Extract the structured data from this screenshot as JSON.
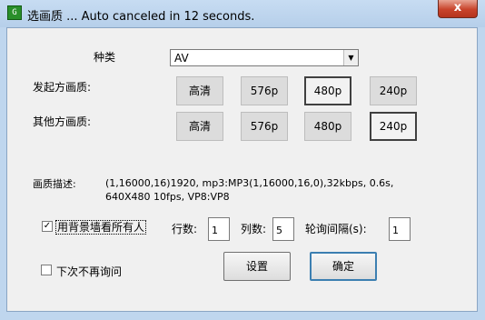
{
  "window": {
    "title": "选画质 ... Auto canceled in 12 seconds.",
    "icon_name": "app-icon",
    "close_label": "x"
  },
  "type": {
    "label": "种类",
    "selected": "AV",
    "arrow": "▼"
  },
  "local_quality": {
    "label": "发起方画质:",
    "options": [
      "高清",
      "576p",
      "480p",
      "240p"
    ],
    "selected": "480p"
  },
  "remote_quality": {
    "label": "其他方画质:",
    "options": [
      "高清",
      "576p",
      "480p",
      "240p"
    ],
    "selected": "240p"
  },
  "description": {
    "label": "画质描述:",
    "line1": "(1,16000,16)1920, mp3:MP3(1,16000,16,0),32kbps, 0.6s,",
    "line2": "640X480 10fps, VP8:VP8"
  },
  "wall": {
    "checked": true,
    "check_mark": "✓",
    "label": "用背景墙看所有人",
    "rows_label": "行数:",
    "rows_value": "1",
    "cols_label": "列数:",
    "cols_value": "5",
    "interval_label": "轮询间隔(s):",
    "interval_value": "1"
  },
  "dont_ask": {
    "checked": false,
    "label": "下次不再询问"
  },
  "buttons": {
    "settings": "设置",
    "ok": "确定"
  }
}
